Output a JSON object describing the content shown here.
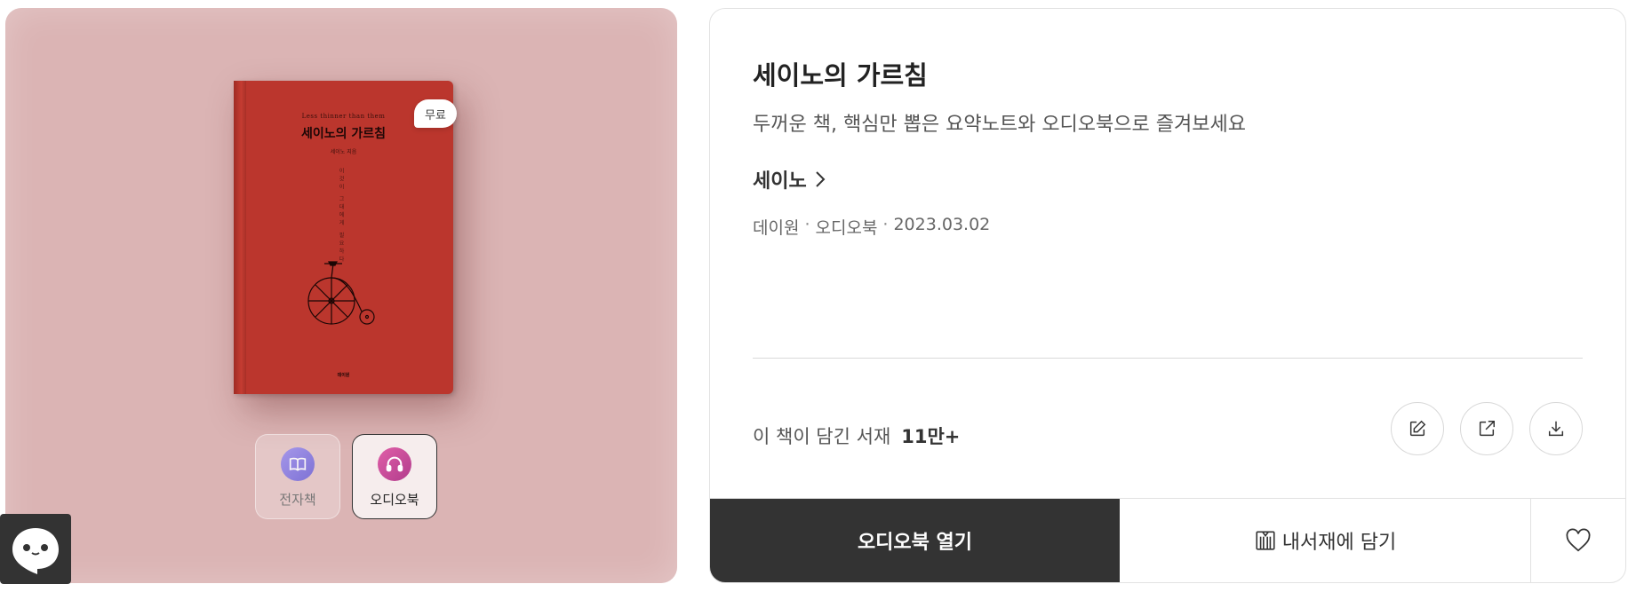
{
  "cover": {
    "book_subtitle": "Less thinner than them",
    "book_title": "세이노의 가르침",
    "book_author": "세이노 지음",
    "book_vertical_text": "이것이 그대에게 필요하다",
    "book_publisher": "데이원",
    "free_badge": "무료",
    "formats": [
      {
        "label": "전자책",
        "icon": "book-open-icon",
        "selected": false
      },
      {
        "label": "오디오북",
        "icon": "headphones-icon",
        "selected": true
      }
    ],
    "background_color": "#dbb4b4",
    "book_color": "#bb362d"
  },
  "info": {
    "title": "세이노의 가르침",
    "subtitle": "두꺼운 책, 핵심만 뽑은 요약노트와 오디오북으로 즐겨보세요",
    "author": "세이노",
    "meta": {
      "publisher": "데이원",
      "format": "오디오북",
      "date": "2023.03.02"
    },
    "shelf_label": "이 책이 담긴 서재",
    "shelf_count": "11만+",
    "actions": [
      {
        "icon": "edit-icon"
      },
      {
        "icon": "share-icon"
      },
      {
        "icon": "download-icon"
      }
    ],
    "open_button": "오디오북 열기",
    "add_shelf_button": "내서재에 담기",
    "primary_color": "#333333"
  }
}
